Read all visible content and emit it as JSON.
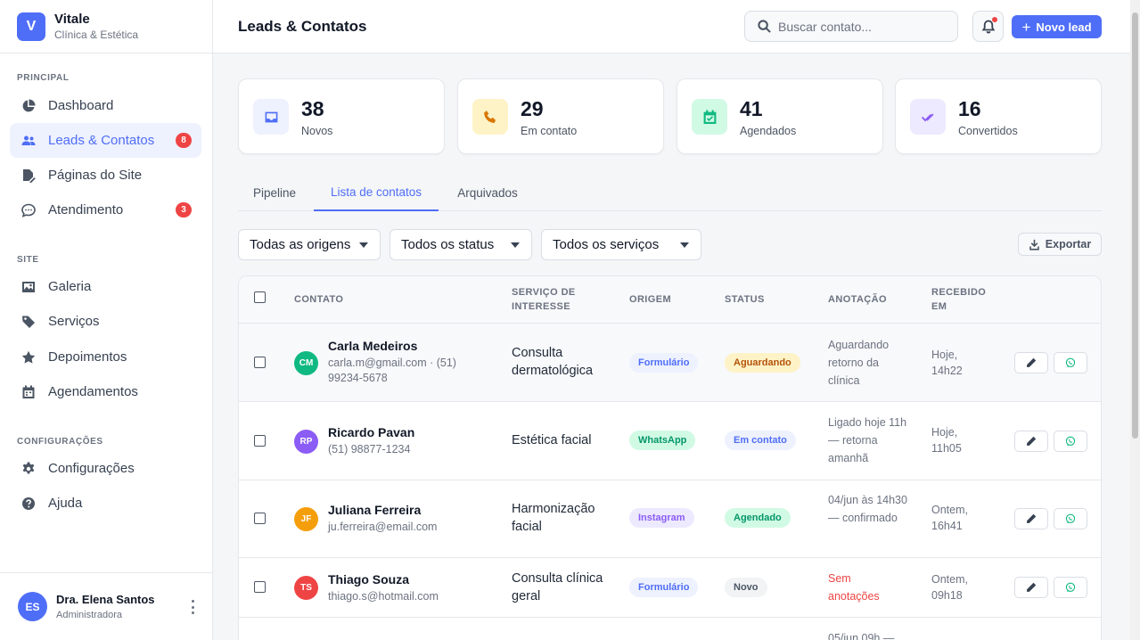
{
  "brand": {
    "initial": "V",
    "name": "Vitale",
    "subtitle": "Clínica & Estética"
  },
  "sidebar": {
    "sections": [
      "PRINCIPAL",
      "SITE",
      "CONFIGURAÇÕES"
    ],
    "items": [
      {
        "label": "Dashboard",
        "icon": "chart-pie-icon"
      },
      {
        "label": "Leads & Contatos",
        "icon": "users-icon",
        "badge": "8",
        "active": true
      },
      {
        "label": "Páginas do Site",
        "icon": "file-edit-icon"
      },
      {
        "label": "Atendimento",
        "icon": "chat-icon",
        "badge": "3"
      },
      {
        "label": "Galeria",
        "icon": "image-icon"
      },
      {
        "label": "Serviços",
        "icon": "tag-icon"
      },
      {
        "label": "Depoimentos",
        "icon": "star-icon"
      },
      {
        "label": "Agendamentos",
        "icon": "calendar-icon"
      },
      {
        "label": "Configurações",
        "icon": "gear-icon"
      },
      {
        "label": "Ajuda",
        "icon": "help-icon"
      }
    ],
    "user": {
      "initials": "ES",
      "name": "Dra. Elena Santos",
      "role": "Administradora"
    }
  },
  "header": {
    "title": "Leads & Contatos",
    "search_placeholder": "Buscar contato...",
    "new_lead_label": "Novo lead"
  },
  "stats": [
    {
      "value": "38",
      "label": "Novos",
      "icon": "inbox-icon",
      "color": "#4f6ef7",
      "bg": "#eef1fe"
    },
    {
      "value": "29",
      "label": "Em contato",
      "icon": "phone-icon",
      "color": "#d97706",
      "bg": "#fef3c7"
    },
    {
      "value": "41",
      "label": "Agendados",
      "icon": "calendar-check-icon",
      "color": "#10b981",
      "bg": "#d1fae5"
    },
    {
      "value": "16",
      "label": "Convertidos",
      "icon": "double-check-icon",
      "color": "#8b5cf6",
      "bg": "#ede9fe"
    }
  ],
  "tabs": [
    {
      "label": "Pipeline"
    },
    {
      "label": "Lista de contatos",
      "active": true
    },
    {
      "label": "Arquivados"
    }
  ],
  "filters": {
    "origin": "Todas as origens",
    "status": "Todos os status",
    "service": "Todos os serviços",
    "export_label": "Exportar"
  },
  "table": {
    "headers": {
      "contact": "CONTATO",
      "service": "SERVIÇO DE INTERESSE",
      "origin": "ORIGEM",
      "status": "STATUS",
      "note": "ANOTAÇÃO",
      "received": "RECEBIDO EM"
    },
    "rows": [
      {
        "initials": "CM",
        "avatar_color": "#10b981",
        "name": "Carla Medeiros",
        "detail": "carla.m@gmail.com · (51) 99234-5678",
        "service": "Consulta dermatológica",
        "origin": "Formulário",
        "origin_color": "#4f6ef7",
        "origin_bg": "#eef1fe",
        "status": "Aguardando",
        "status_color": "#b45309",
        "status_bg": "#fef3c7",
        "note": "Aguardando retorno da clínica",
        "received": "Hoje, 14h22"
      },
      {
        "initials": "RP",
        "avatar_color": "#8b5cf6",
        "name": "Ricardo Pavan",
        "detail": "(51) 98877-1234",
        "service": "Estética facial",
        "origin": "WhatsApp",
        "origin_color": "#059669",
        "origin_bg": "#d1fae5",
        "status": "Em contato",
        "status_color": "#4f6ef7",
        "status_bg": "#eef1fe",
        "note": "Ligado hoje 11h — retorna amanhã",
        "received": "Hoje, 11h05"
      },
      {
        "initials": "JF",
        "avatar_color": "#f59e0b",
        "name": "Juliana Ferreira",
        "detail": "ju.ferreira@email.com",
        "service": "Harmonização facial",
        "origin": "Instagram",
        "origin_color": "#8b5cf6",
        "origin_bg": "#ede9fe",
        "status": "Agendado",
        "status_color": "#059669",
        "status_bg": "#d1fae5",
        "note": "04/jun às 14h30 — confirmado",
        "received": "Ontem, 16h41"
      },
      {
        "initials": "TS",
        "avatar_color": "#ef4444",
        "name": "Thiago Souza",
        "detail": "thiago.s@hotmail.com",
        "service": "Consulta clínica geral",
        "origin": "Formulário",
        "origin_color": "#4f6ef7",
        "origin_bg": "#eef1fe",
        "status": "Novo",
        "status_color": "#4b5563",
        "status_bg": "#f1f3f5",
        "note": "Sem anotações",
        "note_red": true,
        "received": "Ontem, 09h18"
      },
      {
        "note": "05/jun 09h —"
      }
    ]
  }
}
